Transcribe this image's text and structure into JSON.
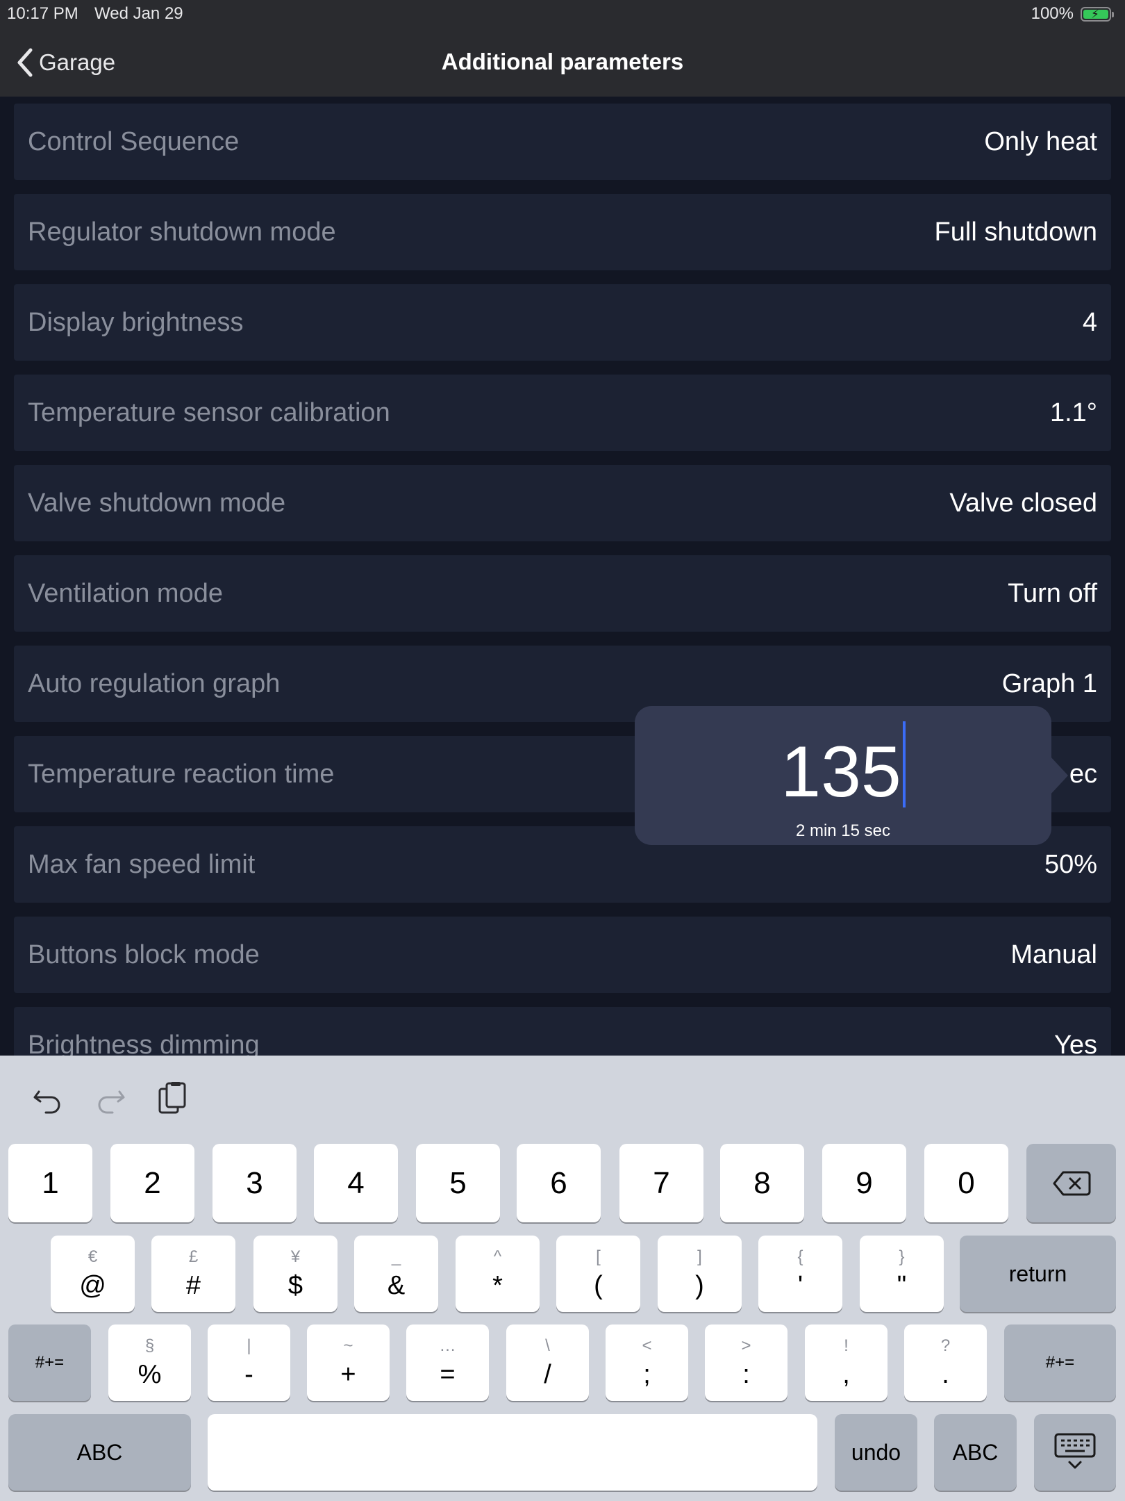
{
  "status_bar": {
    "time": "10:17 PM",
    "date": "Wed Jan 29",
    "battery": "100%"
  },
  "nav": {
    "back_label": "Garage",
    "title": "Additional parameters"
  },
  "rows": [
    {
      "label": "Control Sequence",
      "value": "Only heat"
    },
    {
      "label": "Regulator shutdown mode",
      "value": "Full shutdown"
    },
    {
      "label": "Display brightness",
      "value": "4"
    },
    {
      "label": "Temperature sensor calibration",
      "value": "1.1°"
    },
    {
      "label": "Valve shutdown mode",
      "value": "Valve closed"
    },
    {
      "label": "Ventilation mode",
      "value": "Turn off"
    },
    {
      "label": "Auto regulation graph",
      "value": "Graph 1"
    },
    {
      "label": "Temperature reaction time",
      "value": "ec"
    },
    {
      "label": "Max fan speed limit",
      "value": "50%"
    },
    {
      "label": "Buttons block mode",
      "value": "Manual"
    },
    {
      "label": "Brightness dimming",
      "value": "Yes"
    }
  ],
  "popover": {
    "value": "135",
    "subtitle": "2 min 15 sec"
  },
  "keyboard": {
    "number_row": [
      "1",
      "2",
      "3",
      "4",
      "5",
      "6",
      "7",
      "8",
      "9",
      "0"
    ],
    "symbol_row1": [
      {
        "sec": "€",
        "main": "@"
      },
      {
        "sec": "£",
        "main": "#"
      },
      {
        "sec": "¥",
        "main": "$"
      },
      {
        "sec": "_",
        "main": "&"
      },
      {
        "sec": "^",
        "main": "*"
      },
      {
        "sec": "[",
        "main": "("
      },
      {
        "sec": "]",
        "main": ")"
      },
      {
        "sec": "{",
        "main": "'"
      },
      {
        "sec": "}",
        "main": "\""
      }
    ],
    "return_label": "return",
    "symbol_row2": [
      {
        "sec": "§",
        "main": "%"
      },
      {
        "sec": "|",
        "main": "-"
      },
      {
        "sec": "~",
        "main": "+"
      },
      {
        "sec": "…",
        "main": "="
      },
      {
        "sec": "\\",
        "main": "/"
      },
      {
        "sec": "<",
        "main": ";"
      },
      {
        "sec": ">",
        "main": ":"
      },
      {
        "sec": "!",
        "main": ","
      },
      {
        "sec": "?",
        "main": "."
      }
    ],
    "shift_label": "#+=",
    "abc_label": "ABC",
    "undo_label": "undo"
  }
}
